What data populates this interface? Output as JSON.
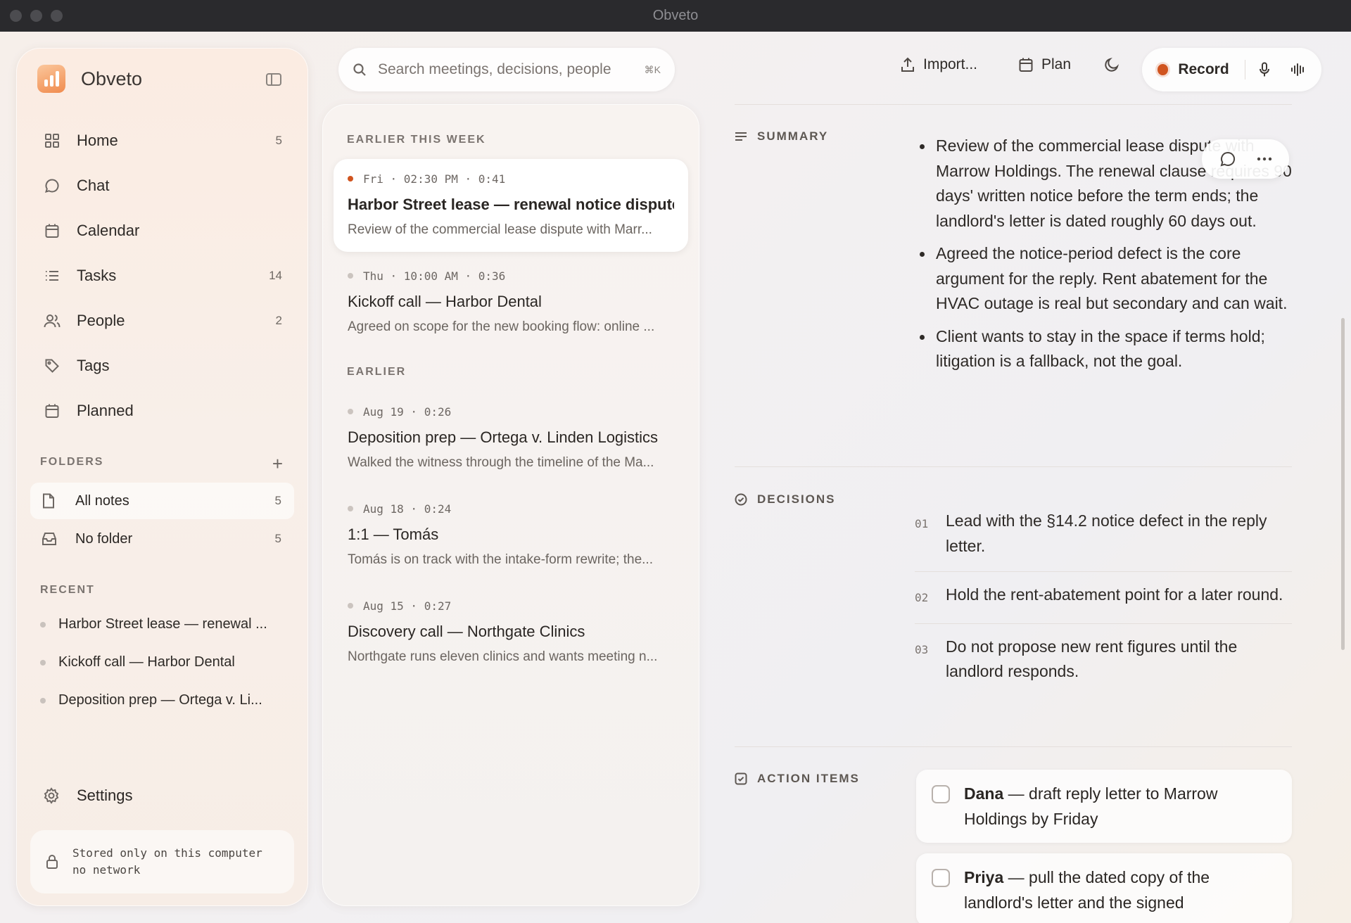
{
  "window": {
    "title": "Obveto"
  },
  "sidebar": {
    "app_name": "Obveto",
    "nav": [
      {
        "label": "Home",
        "count": "5",
        "icon": "grid-icon"
      },
      {
        "label": "Chat",
        "count": "",
        "icon": "chat-bubble-icon"
      },
      {
        "label": "Calendar",
        "count": "",
        "icon": "calendar-icon"
      },
      {
        "label": "Tasks",
        "count": "14",
        "icon": "list-icon"
      },
      {
        "label": "People",
        "count": "2",
        "icon": "people-icon"
      },
      {
        "label": "Tags",
        "count": "",
        "icon": "tag-icon"
      },
      {
        "label": "Planned",
        "count": "",
        "icon": "calendar-icon"
      }
    ],
    "folders_label": "FOLDERS",
    "folders": [
      {
        "label": "All notes",
        "count": "5",
        "icon": "file-icon"
      },
      {
        "label": "No folder",
        "count": "5",
        "icon": "inbox-icon"
      }
    ],
    "recent_label": "RECENT",
    "recent": [
      "Harbor Street lease — renewal ...",
      "Kickoff call — Harbor Dental",
      "Deposition prep — Ortega v. Li..."
    ],
    "settings_label": "Settings",
    "storage_line1": "Stored only on this computer",
    "storage_line2": "no network"
  },
  "search": {
    "placeholder": "Search meetings, decisions, people",
    "shortcut": "⌘K"
  },
  "toolbar": {
    "import_label": "Import...",
    "plan_label": "Plan",
    "record_label": "Record",
    "record_color": "#d0541f"
  },
  "notes": {
    "group1": "EARLIER THIS WEEK",
    "group2": "EARLIER",
    "items": [
      {
        "meta": "Fri · 02:30 PM · 0:41",
        "title": "Harbor Street lease — renewal notice dispute",
        "snippet": "Review of the commercial lease dispute with Marr..."
      },
      {
        "meta": "Thu · 10:00 AM · 0:36",
        "title": "Kickoff call — Harbor Dental",
        "snippet": "Agreed on scope for the new booking flow: online ..."
      },
      {
        "meta": "Aug 19 · 0:26",
        "title": "Deposition prep — Ortega v. Linden Logistics",
        "snippet": "Walked the witness through the timeline of the Ma..."
      },
      {
        "meta": "Aug 18 · 0:24",
        "title": "1:1 — Tomás",
        "snippet": "Tomás is on track with the intake-form rewrite; the..."
      },
      {
        "meta": "Aug 15 · 0:27",
        "title": "Discovery call — Northgate Clinics",
        "snippet": "Northgate runs eleven clinics and wants meeting n..."
      }
    ]
  },
  "detail": {
    "summary_label": "SUMMARY",
    "summary": [
      "Review of the commercial lease dispute with Marrow Holdings. The renewal clause requires 90 days' written notice before the term ends; the landlord's letter is dated roughly 60 days out.",
      "Agreed the notice-period defect is the core argument for the reply. Rent abatement for the HVAC outage is real but secondary and can wait.",
      "Client wants to stay in the space if terms hold; litigation is a fallback, not the goal."
    ],
    "decisions_label": "DECISIONS",
    "decisions": [
      {
        "num": "01",
        "text": "Lead with the §14.2 notice defect in the reply letter."
      },
      {
        "num": "02",
        "text": "Hold the rent-abatement point for a later round."
      },
      {
        "num": "03",
        "text": "Do not propose new rent figures until the landlord responds."
      }
    ],
    "actions_label": "ACTION ITEMS",
    "actions": [
      {
        "who": "Dana",
        "text": " — draft reply letter to Marrow Holdings by Friday"
      },
      {
        "who": "Priya",
        "text": " — pull the dated copy of the landlord's letter and the signed"
      }
    ]
  }
}
